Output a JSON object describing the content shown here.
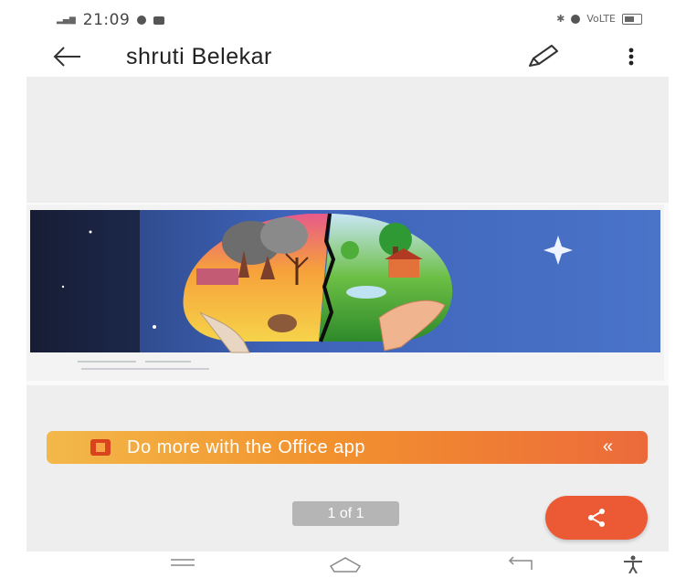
{
  "status_bar": {
    "time": "21:09",
    "signal_text": "Vol LTE",
    "net_text": "VoLTE"
  },
  "app_bar": {
    "title": "shruti Belekar"
  },
  "viewer": {
    "banner_text": "Do more with the Office app",
    "banner_chevron": "«",
    "page_counter": "1 of 1"
  },
  "colors": {
    "banner_start": "#f3b84a",
    "banner_end": "#ec6a3a",
    "share_fab": "#ec5a35",
    "viewer_bg": "#eeeeee"
  },
  "icons": {
    "back": "arrow-left-icon",
    "edit": "pencil-icon",
    "more": "more-vertical-icon",
    "share": "share-icon",
    "office": "office-logo-icon",
    "nav_menu": "menu-icon",
    "nav_home": "home-icon",
    "nav_back": "back-icon",
    "nav_accessibility": "accessibility-icon"
  }
}
